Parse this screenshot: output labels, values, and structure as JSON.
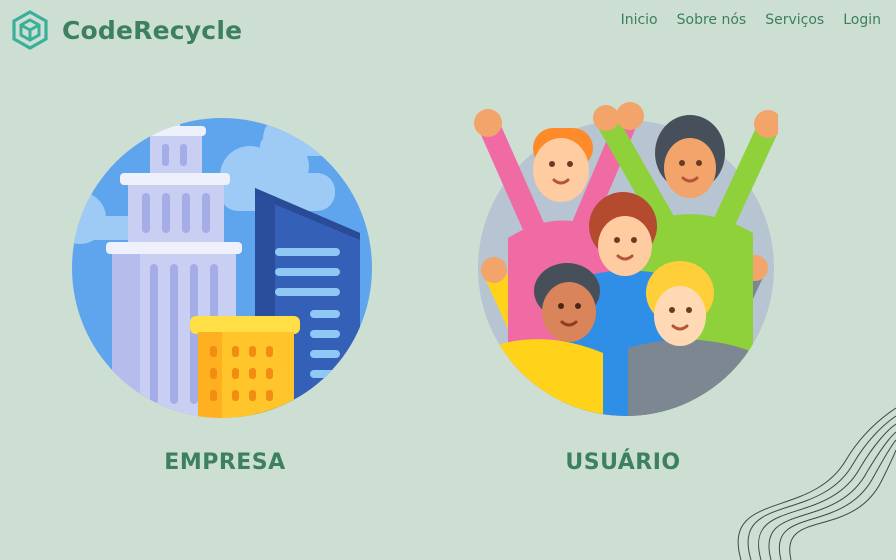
{
  "brand": {
    "name": "CodeRecycle",
    "icon": "recycle-cube-icon"
  },
  "nav": {
    "items": [
      "Inicio",
      "Sobre nós",
      "Serviços",
      "Login"
    ]
  },
  "cards": {
    "empresa": {
      "label": "EMPRESA",
      "icon": "city-buildings-illustration"
    },
    "usuario": {
      "label": "USUÁRIO",
      "icon": "people-group-illustration"
    }
  },
  "colors": {
    "background": "#cddfd3",
    "accent": "#3c8060",
    "logo": "#3ab09a"
  }
}
